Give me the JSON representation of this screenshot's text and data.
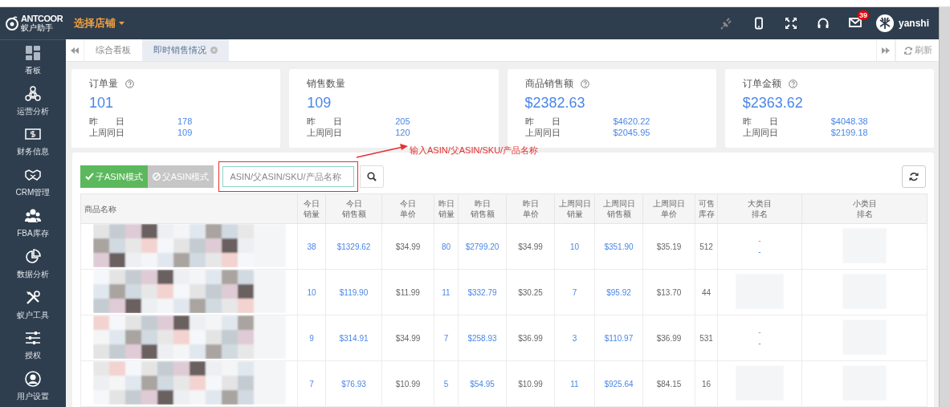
{
  "header": {
    "logo": "ANTCOOR",
    "logo_subtitle": "蚁户助手",
    "store_selector": "选择店铺",
    "mail_count": "39",
    "user": "yanshi"
  },
  "sidebar": {
    "items": [
      {
        "label": "看板"
      },
      {
        "label": "运营分析"
      },
      {
        "label": "财务信息"
      },
      {
        "label": "CRM管理"
      },
      {
        "label": "FBA库存"
      },
      {
        "label": "数据分析"
      },
      {
        "label": "蚁户工具"
      },
      {
        "label": "授权"
      },
      {
        "label": "用户设置"
      }
    ]
  },
  "tabs": [
    {
      "label": "综合看板",
      "selected": false,
      "closable": false
    },
    {
      "label": "即时销售情况",
      "selected": true,
      "closable": true
    }
  ],
  "refresh": "刷新",
  "stats": [
    {
      "title": "订单量",
      "help": true,
      "value": "101",
      "rows": [
        {
          "label": "昨　　日",
          "value": "178"
        },
        {
          "label": "上周同日",
          "value": "109"
        }
      ]
    },
    {
      "title": "销售数量",
      "help": false,
      "value": "109",
      "rows": [
        {
          "label": "昨　　日",
          "value": "205"
        },
        {
          "label": "上周同日",
          "value": "120"
        }
      ]
    },
    {
      "title": "商品销售额",
      "help": true,
      "value": "$2382.63",
      "rows": [
        {
          "label": "昨　　日",
          "value": "$4620.22"
        },
        {
          "label": "上周同日",
          "value": "$2045.95"
        }
      ]
    },
    {
      "title": "订单金额",
      "help": true,
      "value": "$2363.62",
      "rows": [
        {
          "label": "昨　　日",
          "value": "$4048.38"
        },
        {
          "label": "上周同日",
          "value": "$2199.18"
        }
      ]
    }
  ],
  "modes": [
    {
      "label": "子ASIN模式",
      "selected": true
    },
    {
      "label": "父ASIN模式",
      "selected": false
    }
  ],
  "search": {
    "placeholder": "ASIN/父ASIN/SKU/产品名称"
  },
  "annotation": {
    "text": "输入ASIN/父ASIN/SKU/产品名称"
  },
  "table": {
    "columns": [
      {
        "label": [
          "商品名称"
        ],
        "kind": "product"
      },
      {
        "label": [
          "今日",
          "销量"
        ],
        "kind": "link"
      },
      {
        "label": [
          "今日",
          "销售额"
        ],
        "kind": "link"
      },
      {
        "label": [
          "今日",
          "单价"
        ],
        "kind": "plain"
      },
      {
        "label": [
          "昨日",
          "销量"
        ],
        "kind": "link"
      },
      {
        "label": [
          "昨日",
          "销售额"
        ],
        "kind": "link"
      },
      {
        "label": [
          "昨日",
          "单价"
        ],
        "kind": "plain"
      },
      {
        "label": [
          "上周同日",
          "销量"
        ],
        "kind": "link"
      },
      {
        "label": [
          "上周同日",
          "销售额"
        ],
        "kind": "link"
      },
      {
        "label": [
          "上周同日",
          "单价"
        ],
        "kind": "plain"
      },
      {
        "label": [
          "可售",
          "库存"
        ],
        "kind": "plain"
      },
      {
        "label": [
          "大类目",
          "排名"
        ],
        "kind": "rank"
      },
      {
        "label": [
          "小类目",
          "排名"
        ],
        "kind": "rank"
      }
    ],
    "rows": [
      {
        "cells": [
          "",
          "38",
          "$1329.62",
          "$34.99",
          "80",
          "$2799.20",
          "$34.99",
          "10",
          "$351.90",
          "$35.19",
          "512",
          "-\n-",
          ""
        ]
      },
      {
        "cells": [
          "",
          "10",
          "$119.90",
          "$11.99",
          "11",
          "$332.79",
          "$30.25",
          "7",
          "$95.92",
          "$13.70",
          "44",
          "",
          ""
        ]
      },
      {
        "cells": [
          "",
          "9",
          "$314.91",
          "$34.99",
          "7",
          "$258.93",
          "$36.99",
          "3",
          "$110.97",
          "$36.99",
          "531",
          "-\n-",
          ""
        ]
      },
      {
        "cells": [
          "",
          "7",
          "$76.93",
          "$10.99",
          "5",
          "$54.95",
          "$10.99",
          "11",
          "$925.64",
          "$84.15",
          "16",
          "",
          ""
        ]
      }
    ]
  }
}
